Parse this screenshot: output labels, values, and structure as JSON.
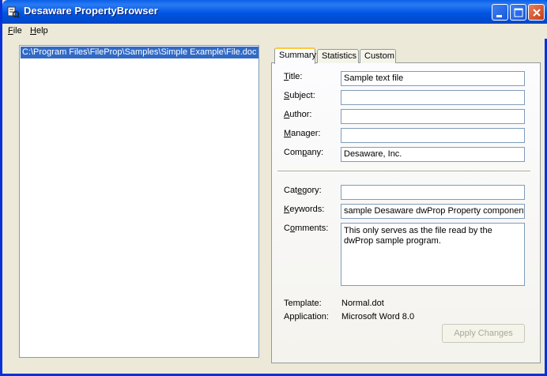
{
  "window": {
    "title": "Desaware PropertyBrowser"
  },
  "menu": {
    "file_label": "File",
    "file_first": "F",
    "file_rest": "ile",
    "help_label": "Help",
    "help_first": "H",
    "help_rest": "elp"
  },
  "file_list": {
    "items": [
      "C:\\Program Files\\FileProp\\Samples\\Simple Example\\File.doc"
    ]
  },
  "tabs": [
    {
      "label": "Summary",
      "selected": true
    },
    {
      "label": "Statistics",
      "selected": false
    },
    {
      "label": "Custom",
      "selected": false
    }
  ],
  "summary": {
    "title": {
      "label_first": "T",
      "label_rest": "itle:",
      "value": "Sample text file"
    },
    "subject": {
      "label_first": "S",
      "label_rest": "ubject:",
      "value": ""
    },
    "author": {
      "label_first": "A",
      "label_rest": "uthor:",
      "value": ""
    },
    "manager": {
      "label_first": "M",
      "label_rest": "anager:",
      "value": ""
    },
    "company": {
      "label_pre": "Com",
      "label_u": "p",
      "label_rest": "any:",
      "value": "Desaware, Inc."
    },
    "category": {
      "label_pre": "Cat",
      "label_u": "e",
      "label_rest": "gory:",
      "value": ""
    },
    "keywords": {
      "label_first": "K",
      "label_rest": "eywords:",
      "value": "sample Desaware dwProp Property component"
    },
    "comments": {
      "label_pre": "C",
      "label_u": "o",
      "label_rest": "mments:",
      "value": "This only serves as the file read by the dwProp sample program."
    },
    "template": {
      "label": "Template:",
      "value": "Normal.dot"
    },
    "application": {
      "label": "Application:",
      "value": "Microsoft Word 8.0"
    },
    "apply_label": "Apply Changes"
  },
  "colors": {
    "titlebar": "#0054e3",
    "selection": "#316ac5",
    "face": "#ece9d8"
  },
  "icons": {
    "app": "app-icon",
    "minimize": "minimize-icon",
    "maximize": "maximize-icon",
    "close": "close-icon"
  }
}
